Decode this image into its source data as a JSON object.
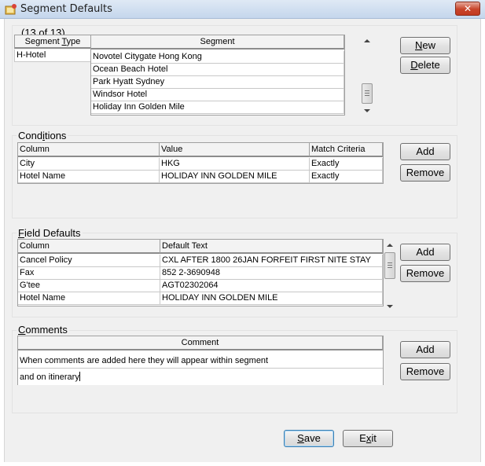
{
  "window": {
    "title": "Segment Defaults",
    "close_glyph": "✕"
  },
  "segments": {
    "counter": "(13 of 13)",
    "headers": {
      "type_pre": "Segment ",
      "type_ul": "T",
      "type_post": "ype",
      "segment": "Segment"
    },
    "type_value": "H-Hotel",
    "rows": [
      "Novotel Citygate Hong Kong",
      "Ocean Beach Hotel",
      "Park Hyatt Sydney",
      "Windsor Hotel",
      "Holiday Inn Golden Mile"
    ],
    "new_button": {
      "ul": "N",
      "rest": "ew"
    },
    "delete_button": {
      "ul": "D",
      "rest": "elete"
    }
  },
  "conditions": {
    "title_pre": "Cond",
    "title_ul": "i",
    "title_post": "tions",
    "headers": [
      "Column",
      "Value",
      "Match Criteria"
    ],
    "rows": [
      [
        "City",
        "HKG",
        "Exactly"
      ],
      [
        "Hotel Name",
        "HOLIDAY INN GOLDEN MILE",
        "Exactly"
      ]
    ],
    "add_label": "Add",
    "remove_label": "Remove"
  },
  "field_defaults": {
    "title_ul": "F",
    "title_rest": "ield Defaults",
    "headers": [
      "Column",
      "Default Text"
    ],
    "rows": [
      [
        "Cancel Policy",
        "CXL AFTER 1800 26JAN FORFEIT FIRST NITE STAY"
      ],
      [
        "Fax",
        "852 2-3690948"
      ],
      [
        "G'tee",
        "AGT02302064"
      ],
      [
        "Hotel Name",
        "HOLIDAY INN GOLDEN MILE"
      ]
    ],
    "add_label": "Add",
    "remove_label": "Remove"
  },
  "comments": {
    "title_ul": "C",
    "title_rest": "omments",
    "header": "Comment",
    "lines": [
      "When comments are added here they will appear within segment",
      "and on itinerary"
    ],
    "add_label": "Add",
    "remove_label": "Remove"
  },
  "footer": {
    "save_button": {
      "ul": "S",
      "rest": "ave"
    },
    "exit_button": {
      "pre": "E",
      "ul": "x",
      "rest": "it"
    }
  },
  "icons": {
    "window": "app-window-icon",
    "close": "close-icon",
    "scroll_up": "scroll-up-arrow-icon",
    "scroll_down": "scroll-down-arrow-icon"
  }
}
